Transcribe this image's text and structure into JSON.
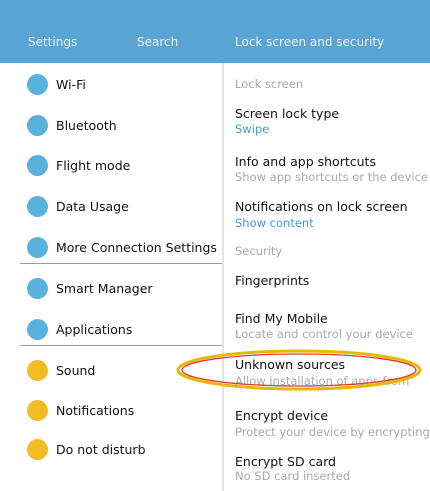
{
  "header": {
    "settings_label": "Settings",
    "search_label": "Search",
    "title": "Lock screen and security",
    "color": "#5aa4d4"
  },
  "sidebar": {
    "items": [
      {
        "label": "Wi-Fi",
        "dot_color": "#58b2dc"
      },
      {
        "label": "Bluetooth",
        "dot_color": "#58b2dc"
      },
      {
        "label": "Flight mode",
        "dot_color": "#58b2dc"
      },
      {
        "label": "Data Usage",
        "dot_color": "#58b2dc"
      },
      {
        "label": "More Connection Settings",
        "dot_color": "#58b2dc"
      },
      {
        "label": "Smart Manager",
        "dot_color": "#58b2dc"
      },
      {
        "label": "Applications",
        "dot_color": "#58b2dc"
      },
      {
        "label": "Sound",
        "dot_color": "#f2bc24"
      },
      {
        "label": "Notifications",
        "dot_color": "#f2bc24"
      },
      {
        "label": "Do not disturb",
        "dot_color": "#f2bc24"
      }
    ]
  },
  "main": {
    "categories": {
      "lock_screen": "Lock screen",
      "security": "Security"
    },
    "rows": [
      {
        "title": "Screen lock type",
        "subtitle": "Swipe"
      },
      {
        "title": "Info and app shortcuts",
        "subtitle": "Show app shortcuts or the device"
      },
      {
        "title": "Notifications on lock screen",
        "subtitle": "Show content"
      },
      {
        "title": "Fingerprints",
        "subtitle": ""
      },
      {
        "title": "Find My Mobile",
        "subtitle": "Locate and control your device"
      },
      {
        "title": "Unknown sources",
        "subtitle": "Allow installation of apps from"
      },
      {
        "title": "Encrypt device",
        "subtitle": "Protect your device by encrypting"
      },
      {
        "title": "Encrypt SD card",
        "subtitle": "No SD card inserted"
      }
    ]
  },
  "annotation": {
    "highlight_color": "#e8b800",
    "highlight_inner": "#e23b2f"
  }
}
